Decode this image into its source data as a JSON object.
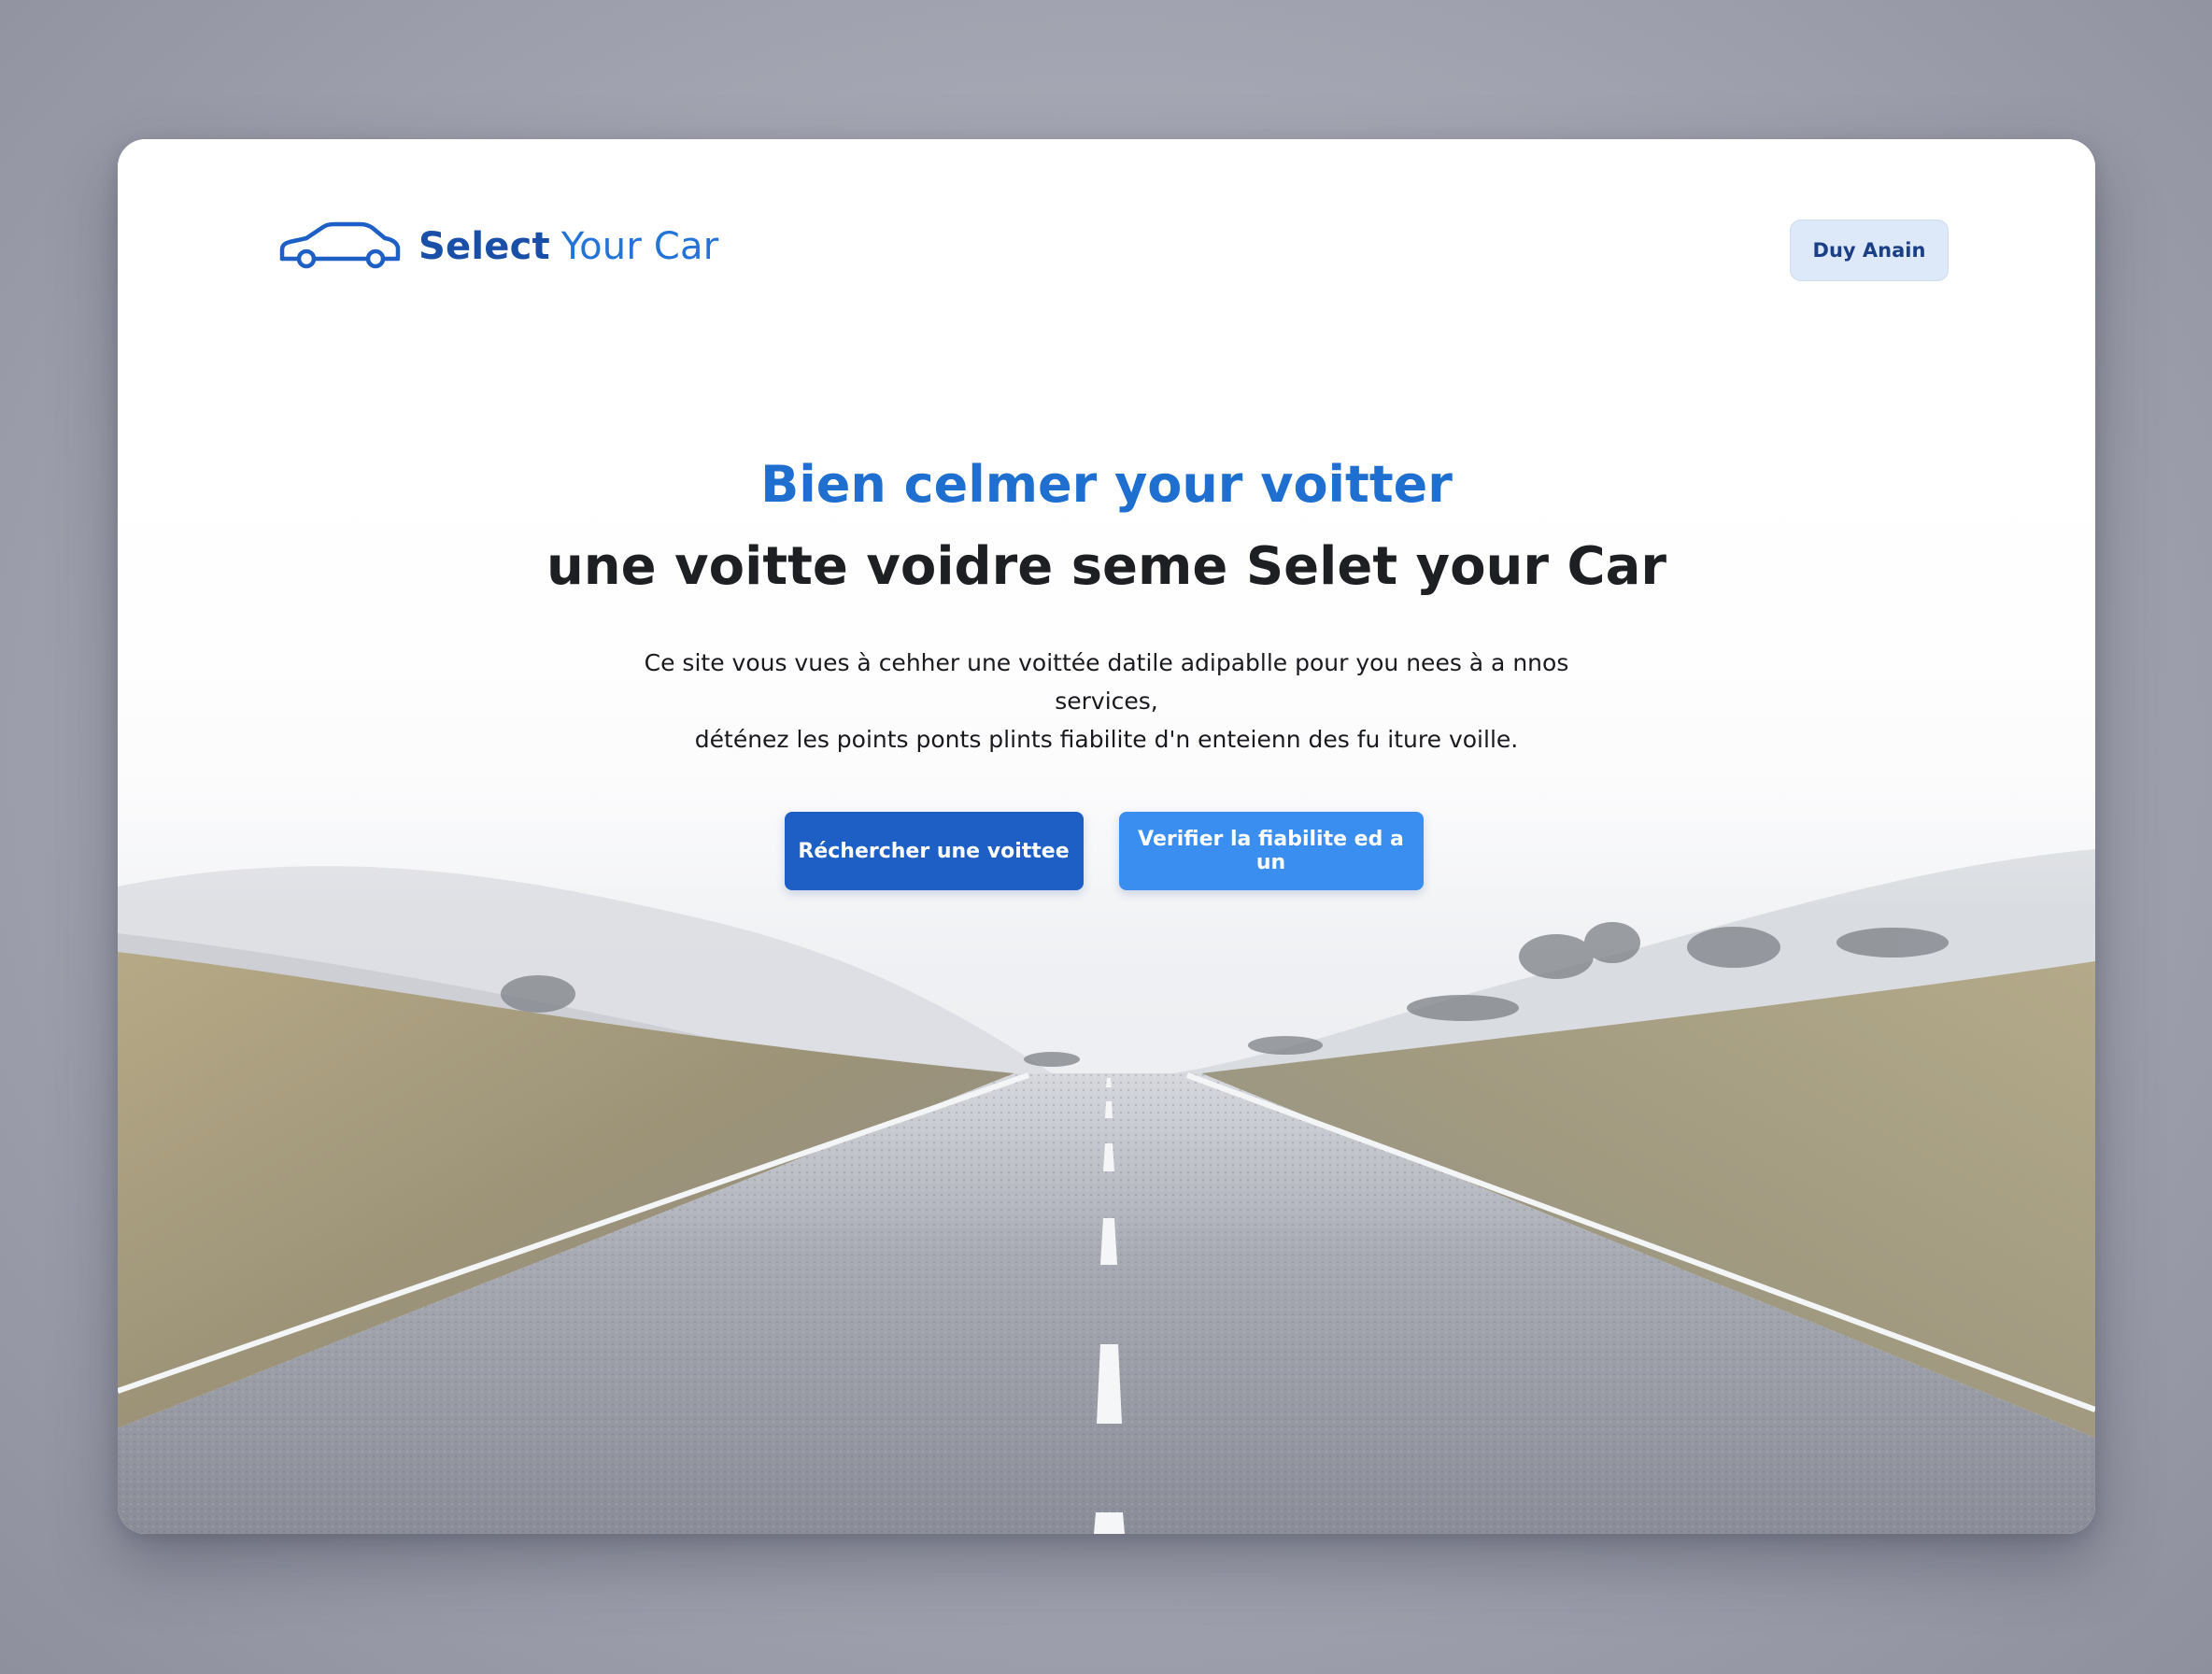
{
  "brand": {
    "name_part1": "Select",
    "name_part2": "Your Car",
    "logo_icon": "car-outline-icon",
    "primary_color": "#1a4fa8",
    "accent_color": "#2473d9"
  },
  "header": {
    "user_button_label": "Duy Anain"
  },
  "hero": {
    "title": "Bien celmer your voitter",
    "subtitle": "une voitte voidre seme Selet your Car",
    "description_line1": "Ce site vous vues à cehher une voittée datile adipablle pour you nees à a nnos services,",
    "description_line2": "déténez les points ponts plints fiabilite d'n enteienn des fu iture voille.",
    "background": "open-road-landscape"
  },
  "actions": {
    "primary_label": "Réchercher une voittee",
    "secondary_label": "Verifier la fiabilite ed a un",
    "primary_color": "#1d5fc4",
    "secondary_color": "#3a8ef0"
  }
}
